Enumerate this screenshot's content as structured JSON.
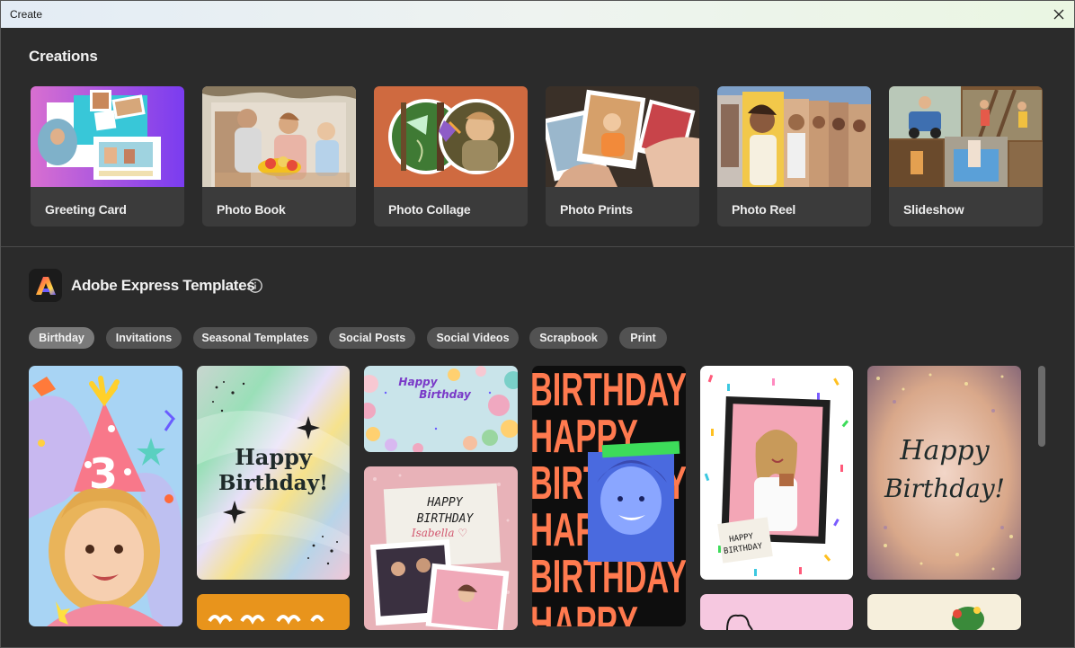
{
  "window": {
    "title": "Create"
  },
  "creations": {
    "heading": "Creations",
    "items": [
      {
        "label": "Greeting Card"
      },
      {
        "label": "Photo Book"
      },
      {
        "label": "Photo Collage"
      },
      {
        "label": "Photo Prints"
      },
      {
        "label": "Photo Reel"
      },
      {
        "label": "Slideshow"
      }
    ]
  },
  "templates": {
    "heading": "Adobe Express Templates",
    "filters": [
      {
        "label": "Birthday",
        "active": true
      },
      {
        "label": "Invitations"
      },
      {
        "label": "Seasonal Templates"
      },
      {
        "label": "Social Posts"
      },
      {
        "label": "Social Videos"
      },
      {
        "label": "Scrapbook"
      },
      {
        "label": "Print"
      }
    ],
    "cards": {
      "kids_number": "3",
      "holo_line1": "Happy",
      "holo_line2": "Birthday!",
      "balloon_line1": "Happy",
      "balloon_line2": "Birthday",
      "pink_line1": "HAPPY",
      "pink_line2": "BIRTHDAY",
      "pink_name": "Isabella ♡",
      "type_lines": [
        "BIRTHDAY",
        "HAPPY",
        "BIRTHDAY",
        "HAPPY",
        "BIRTHDAY",
        "HAPPY"
      ],
      "confetti_note1": "HAPPY",
      "confetti_note2": "BIRTHDAY",
      "glitter_line1": "Happy",
      "glitter_line2": "Birthday!"
    }
  },
  "colors": {
    "background": "#2b2b2b",
    "card": "#3b3b3b",
    "chip": "#525252",
    "chip_active": "#7a7a7a",
    "accent_orange": "#ff7a4f",
    "accent_green": "#3ddc5a"
  }
}
